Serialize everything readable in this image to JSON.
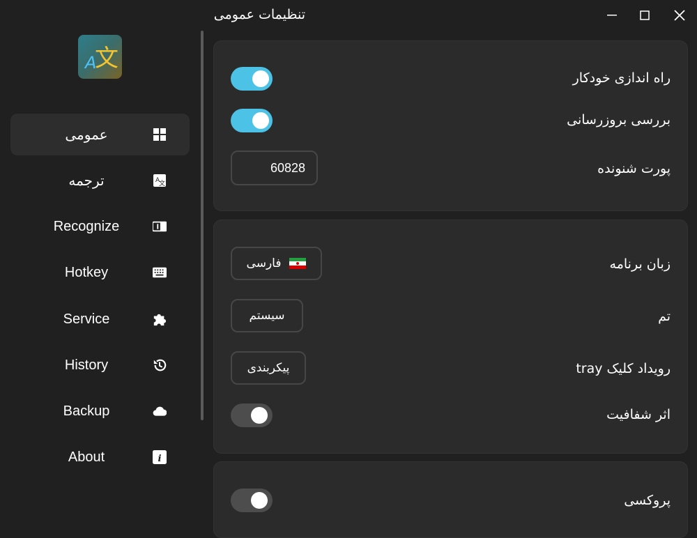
{
  "window": {
    "title": "تنظیمات عمومی"
  },
  "sidebar": {
    "items": [
      {
        "label": "عمومی",
        "icon": "grid-icon"
      },
      {
        "label": "ترجمه",
        "icon": "translate-icon"
      },
      {
        "label": "Recognize",
        "icon": "ocr-icon"
      },
      {
        "label": "Hotkey",
        "icon": "keyboard-icon"
      },
      {
        "label": "Service",
        "icon": "puzzle-icon"
      },
      {
        "label": "History",
        "icon": "history-icon"
      },
      {
        "label": "Backup",
        "icon": "cloud-icon"
      },
      {
        "label": "About",
        "icon": "info-icon"
      }
    ]
  },
  "general": {
    "autostart_label": "راه اندازی خودکار",
    "autostart": true,
    "check_update_label": "بررسی بروزرسانی",
    "check_update": true,
    "port_label": "پورت شنونده",
    "port_value": "60828"
  },
  "appearance": {
    "language_label": "زبان برنامه",
    "language_value": "فارسی",
    "theme_label": "تم",
    "theme_value": "سیستم",
    "tray_label": "رویداد کلیک tray",
    "tray_value": "پیکربندی",
    "transparency_label": "اثر شفافیت",
    "transparency": false
  },
  "network": {
    "proxy_label": "پروکسی",
    "proxy": false
  },
  "colors": {
    "accent": "#4cc2e6",
    "background": "#202020",
    "card": "#2b2b2b"
  }
}
